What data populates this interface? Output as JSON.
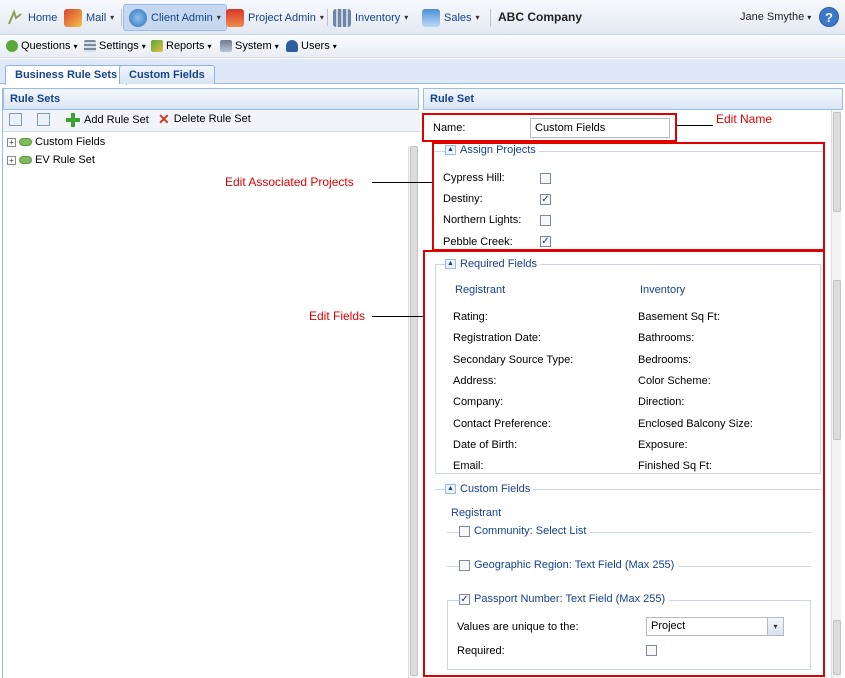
{
  "topnav": {
    "home": "Home",
    "mail": "Mail",
    "client_admin": "Client Admin",
    "project_admin": "Project Admin",
    "inventory": "Inventory",
    "sales": "Sales",
    "company": "ABC Company",
    "user": "Jane Smythe",
    "help": "?"
  },
  "subnav": {
    "questions": "Questions",
    "settings": "Settings",
    "reports": "Reports",
    "system": "System",
    "users": "Users"
  },
  "tabs": [
    {
      "label": "Business Rule Sets",
      "active": true
    },
    {
      "label": "Custom Fields",
      "active": false
    }
  ],
  "left": {
    "title": "Rule Sets",
    "add_label": "Add Rule Set",
    "delete_label": "Delete Rule Set",
    "tree": [
      "Custom Fields",
      "EV Rule Set"
    ]
  },
  "right": {
    "title": "Rule Set",
    "name_label": "Name:",
    "name_value": "Custom Fields",
    "assign_projects": {
      "legend": "Assign Projects",
      "projects": [
        {
          "label": "Cypress Hill:",
          "checked": false
        },
        {
          "label": "Destiny:",
          "checked": true
        },
        {
          "label": "Northern Lights:",
          "checked": false
        },
        {
          "label": "Pebble Creek:",
          "checked": true
        }
      ]
    },
    "required_fields": {
      "legend": "Required Fields",
      "col1_head": "Registrant",
      "col2_head": "Inventory",
      "col1": [
        "Rating:",
        "Registration Date:",
        "Secondary Source Type:",
        "Address:",
        "Company:",
        "Contact Preference:",
        "Date of Birth:",
        "Email:"
      ],
      "col2": [
        "Basement Sq Ft:",
        "Bathrooms:",
        "Bedrooms:",
        "Color Scheme:",
        "Direction:",
        "Enclosed Balcony Size:",
        "Exposure:",
        "Finished Sq Ft:"
      ]
    },
    "custom_fields": {
      "legend": "Custom Fields",
      "group_head": "Registrant",
      "items": [
        {
          "label": "Community: Select List",
          "checked": false
        },
        {
          "label": "Geographic Region: Text Field (Max 255)",
          "checked": false
        },
        {
          "label": "Passport Number: Text Field (Max 255)",
          "checked": true
        }
      ],
      "unique_label": "Values are unique to the:",
      "unique_value": "Project",
      "required_label": "Required:"
    }
  },
  "annotations": {
    "edit_name": "Edit Name",
    "edit_projects": "Edit Associated Projects",
    "edit_fields": "Edit Fields",
    "color": "#e00000"
  },
  "check_mark": "✓",
  "caret": "▾"
}
